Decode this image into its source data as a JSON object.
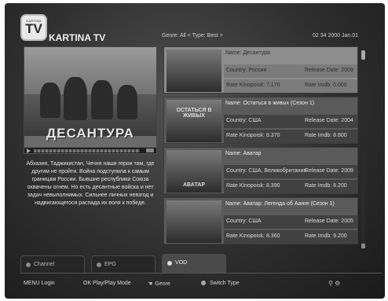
{
  "header": {
    "logo_small": "KARTINA",
    "logo_big": "TV",
    "app_title": "KARTINA TV",
    "filter_info": "Genre: All < Type: Best >",
    "clock": "02 34  2000 Jan.01"
  },
  "preview": {
    "poster_title": "ДЕСАНТУРА",
    "description": "Абхазия, Таджикистан, Чечня наши герои там, где другим не пройти. Война подступила к самым границам России. Бывшие республики Союза охвачены огнем. Но есть десантные войска и нет задач невыполнимых. Сильнее личных невзгод и надвигающегося распада их воля к победе."
  },
  "list": {
    "items": [
      {
        "name": "Name: Десантура",
        "thumb_text": "",
        "country": "Country: Россия",
        "release": "Release Date: 2009",
        "kinopoisk": "Rate Kinopoisk: 7.170",
        "imdb": "Rate Imdb: 0.000",
        "selected": true
      },
      {
        "name": "Name: Остаться в живых  (Сезон 1)",
        "thumb_text": "ОСТАТЬСЯ В ЖИВЫХ",
        "country": "Country: США",
        "release": "Release Date: 2004",
        "kinopoisk": "Rate Kinopoisk: 8.370",
        "imdb": "Rate Imdb: 8.800",
        "selected": false
      },
      {
        "name": "Name: Аватар",
        "thumb_text": "АВАТАР",
        "country": "Country: США, Великобритания",
        "release": "Release Date: 2009",
        "kinopoisk": "Rate Kinopoisk: 8.390",
        "imdb": "Rate Imdb: 8.200",
        "selected": false
      },
      {
        "name": "Name: Аватар: Легенда об Аанге  (Сезон 1)",
        "thumb_text": "",
        "country": "Country: США",
        "release": "Release Date: 2005",
        "kinopoisk": "Rate Kinopoisk: 8.360",
        "imdb": "Rate Imdb: 9.200",
        "selected": false
      }
    ]
  },
  "tabs": [
    {
      "label": "Channel",
      "active": false
    },
    {
      "label": "EPG",
      "active": false
    },
    {
      "label": "VOD",
      "active": true
    }
  ],
  "footer": {
    "menu": "MENU Login",
    "ok": "OK Play/Play Mode",
    "genre": "Genre",
    "switch_type": "Switch Type"
  },
  "colors": {
    "background": "#2e2e2e",
    "selected_row": "#8d8d8d",
    "row": "#5a5a5a"
  },
  "icons": [
    "play-icon",
    "stop-icon",
    "hand-icon",
    "colored-button-icon",
    "search-icon",
    "settings-icon"
  ]
}
